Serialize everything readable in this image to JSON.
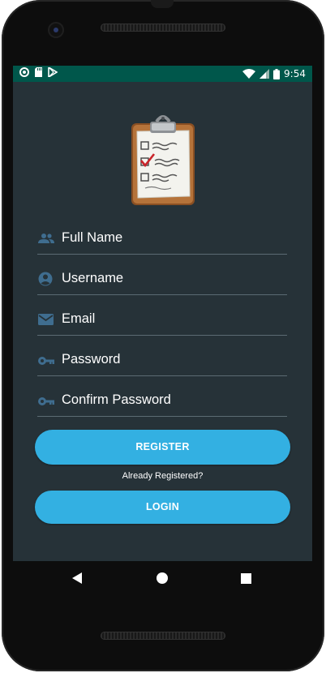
{
  "status_bar": {
    "time": "9:54",
    "icons": [
      "circle-notification-icon",
      "sd-card-icon",
      "play-store-icon",
      "wifi-icon",
      "cell-signal-icon",
      "battery-icon"
    ],
    "bg_color": "#00574b"
  },
  "app": {
    "logo_icon": "clipboard-checklist-icon",
    "fields": [
      {
        "placeholder": "Full Name",
        "icon": "people-icon"
      },
      {
        "placeholder": "Username",
        "icon": "account-circle-icon"
      },
      {
        "placeholder": "Email",
        "icon": "mail-icon"
      },
      {
        "placeholder": "Password",
        "icon": "key-icon"
      },
      {
        "placeholder": "Confirm Password",
        "icon": "key-icon"
      }
    ],
    "register_label": "REGISTER",
    "already_registered": "Already Registered?",
    "login_label": "LOGIN",
    "colors": {
      "background": "#263238",
      "button": "#33b0e2",
      "icon": "#3f6d8f"
    }
  },
  "nav_bar": {
    "icons": [
      "back-icon",
      "home-icon",
      "recents-icon"
    ]
  }
}
